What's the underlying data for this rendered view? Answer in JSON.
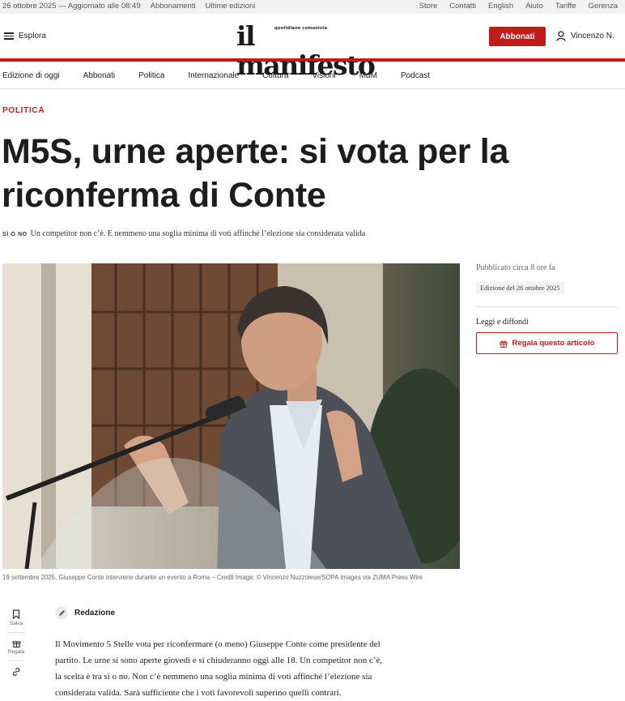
{
  "topbar": {
    "date": "26 ottobre 2025 — Aggiornato alle 08:49",
    "left_links": [
      "Abbonamenti",
      "Ultime edizioni"
    ],
    "right_links": [
      "Store",
      "Contatti",
      "English",
      "Aiuto",
      "Tariffe",
      "Gerenza"
    ]
  },
  "header": {
    "explore_label": "Esplora",
    "logo_text": "il manifesto",
    "logo_sub": "quotidiano comunista",
    "subscribe_label": "Abbonati",
    "user_name": "Vincenzo N.",
    "brand_color": "#c21b1b"
  },
  "nav": {
    "items": [
      "Edizione di oggi",
      "Abbonati",
      "Politica",
      "Internazionale",
      "Cultura",
      "Visioni",
      "MdM",
      "Podcast"
    ]
  },
  "article": {
    "kicker": "POLITICA",
    "title": "M5S, urne aperte: si vota per la riconferma di Conte",
    "tag": "SÌ O NO",
    "subtitle": "Un competitor non c’è. E nemmeno una soglia minima di voti affinché l’elezione sia considerata valida",
    "caption": "19 settembre 2025, Giuseppe Conte interviene durante un evento a Roma – Credit Image: © Vincenzo Nuzzolese/SOPA Images via ZUMA Press Wire",
    "author": "Redazione",
    "body_lines": [
      "Il Movimento 5 Stelle vota per riconfermare (o meno) Giuseppe Conte come presidente del",
      "partito. Le urne si sono aperte giovedì e si chiuderanno oggi alle 18. Un competitor non c’è,",
      "la scelta è tra sì o no. Non c’è nemmeno una soglia minima di voti affinché l’elezione sia",
      "considerata valida. Sarà sufficiente che i voti favorevoli superino quelli contrari."
    ]
  },
  "sidebar": {
    "published": "Pubblicato circa 8 ore fa",
    "edition": "Edizione del 26 ottobre 2025",
    "share_label": "Leggi e diffondi",
    "gift_button": "Regala questo articolo"
  },
  "tools": {
    "save_label": "Salva",
    "gift_label": "Regala"
  }
}
